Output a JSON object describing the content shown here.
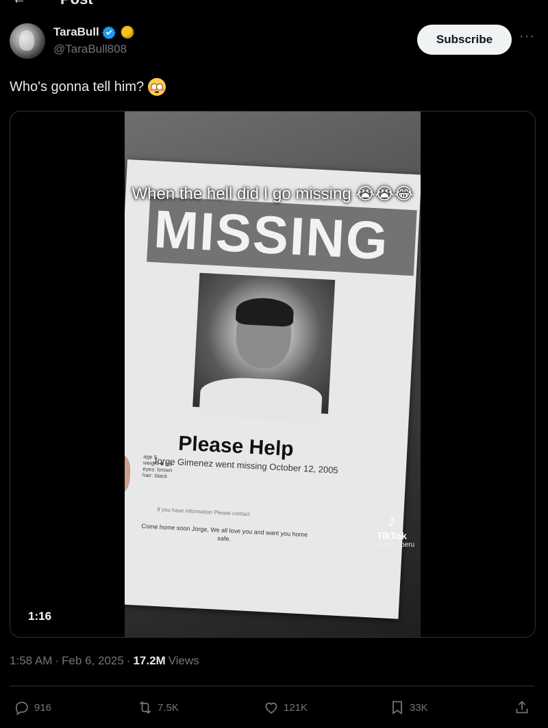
{
  "top": {
    "back_glyph": "←",
    "title": "Post"
  },
  "author": {
    "name": "TaraBull",
    "handle": "@TaraBull808"
  },
  "subscribe_label": "Subscribe",
  "more_glyph": "···",
  "tweet": {
    "text": "Who's gonna tell him?",
    "emoji": "flushed-face"
  },
  "video": {
    "overlay_text": "When the hell did I go missing 😭😭😂",
    "poster": {
      "headline": "MISSING",
      "please_help": "Please Help",
      "went_missing": "Jorge Gimenez went missing October 12, 2005",
      "stats": [
        "age 5",
        "weight ■ lbs",
        "eyes: brown",
        "hair: black"
      ],
      "contact": "If you have information Please contact",
      "come_home": "Come home soon Jorge,  We all love you and want you home safe."
    },
    "watermark": {
      "brand": "TikTok",
      "user": "@ adrian_peru"
    },
    "duration": "1:16"
  },
  "meta": {
    "time": "1:58 AM",
    "sep1": "·",
    "date": "Feb 6, 2025",
    "sep2": "·",
    "views_count": "17.2M",
    "views_label": "Views"
  },
  "actions": {
    "replies": "916",
    "reposts": "7.5K",
    "likes": "121K",
    "bookmarks": "33K"
  },
  "colors": {
    "background": "#000000",
    "text": "#e7e9ea",
    "muted": "#71767b",
    "verified": "#1d9bf0",
    "border": "#2f3336"
  }
}
